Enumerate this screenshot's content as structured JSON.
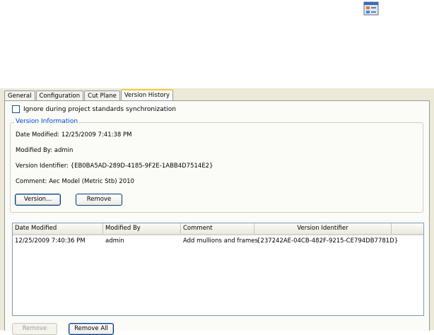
{
  "toolbar_icon": "properties-icon",
  "tabs": [
    {
      "label": "General",
      "active": false
    },
    {
      "label": "Configuration",
      "active": false
    },
    {
      "label": "Cut Plane",
      "active": false
    },
    {
      "label": "Version History",
      "active": true
    }
  ],
  "ignore_checkbox": {
    "label": "Ignore during project standards synchronization",
    "checked": false
  },
  "version_info": {
    "legend": "Version Information",
    "date_modified": "Date Modified: 12/25/2009 7:41:38 PM",
    "modified_by": "Modified By: admin",
    "version_identifier": "Version Identifier: {EB0BA5AD-289D-4185-9F2E-1ABB4D7514E2}",
    "comment": "Comment: Aec Model (Metric Stb) 2010",
    "version_button": "Version...",
    "remove_button": "Remove"
  },
  "history_table": {
    "columns": [
      "Date Modified",
      "Modified By",
      "Comment",
      "Version Identifier"
    ],
    "rows": [
      [
        "12/25/2009 7:40:36 PM",
        "admin",
        "Add mullions and frames",
        "{237242AE-04CB-482F-9215-CE794DB7781D}"
      ]
    ]
  },
  "bottom_buttons": {
    "remove": "Remove",
    "remove_all": "Remove All"
  }
}
